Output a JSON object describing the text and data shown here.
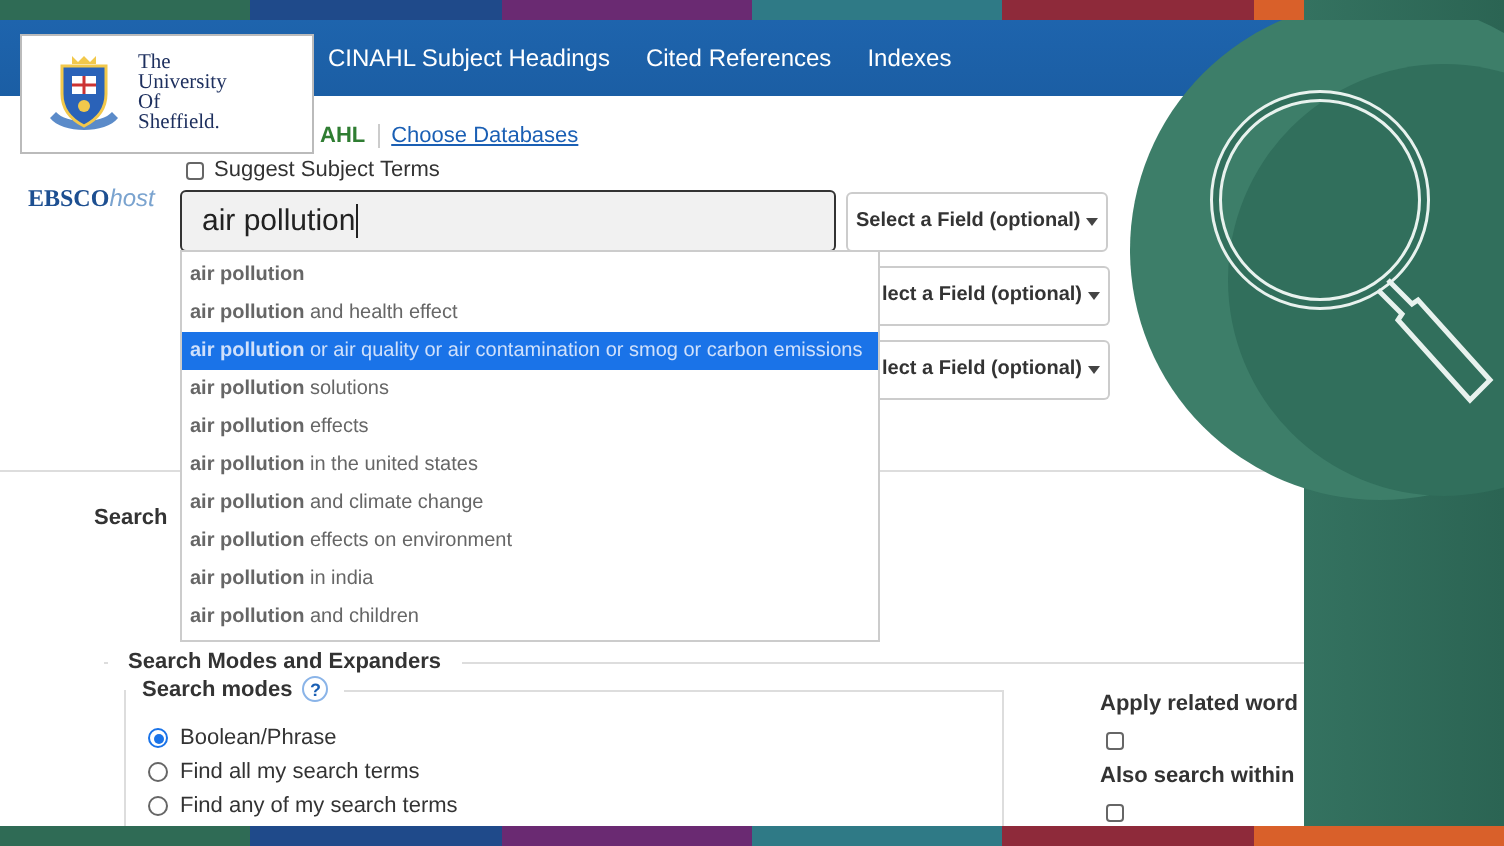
{
  "nav": {
    "items": [
      "CINAHL Subject Headings",
      "Cited References",
      "Indexes"
    ]
  },
  "university_logo": {
    "lines": [
      "The",
      "University",
      "Of",
      "Sheffield."
    ]
  },
  "brand": {
    "name": "EBSCO",
    "suffix": "host"
  },
  "database": {
    "name": "AHL",
    "link": "Choose Databases"
  },
  "suggest_subject_terms": {
    "label": "Suggest Subject Terms",
    "checked": false
  },
  "search": {
    "value": "air pollution"
  },
  "field_selects": [
    {
      "label": "Select a Field (optional)"
    },
    {
      "label": "lect a Field (optional)"
    },
    {
      "label": "lect a Field (optional)"
    }
  ],
  "suggestions": [
    {
      "text": "**air pollution**",
      "selected": false
    },
    {
      "text": "**air pollution** and health effect",
      "selected": false
    },
    {
      "text": "**air pollution** or air quality or air contamination or smog or carbon emissions",
      "selected": true
    },
    {
      "text": "**air pollution** solutions",
      "selected": false
    },
    {
      "text": "**air pollution** effects",
      "selected": false
    },
    {
      "text": "**air pollution** in the united states",
      "selected": false
    },
    {
      "text": "**air pollution** and climate change",
      "selected": false
    },
    {
      "text": "**air pollution** effects on environment",
      "selected": false
    },
    {
      "text": "**air pollution** in india",
      "selected": false
    },
    {
      "text": "**air pollution** and children",
      "selected": false
    }
  ],
  "search_options_heading": "Search",
  "modes_section": {
    "title": "Search Modes and Expanders",
    "modes_title": "Search modes",
    "help": "?",
    "modes": [
      {
        "label": "Boolean/Phrase",
        "selected": true
      },
      {
        "label": "Find all my search terms",
        "selected": false
      },
      {
        "label": "Find any of my search terms",
        "selected": false
      }
    ]
  },
  "expanders": [
    {
      "label": "Apply related word",
      "checked": false
    },
    {
      "label": "Also search within",
      "checked": false
    }
  ]
}
